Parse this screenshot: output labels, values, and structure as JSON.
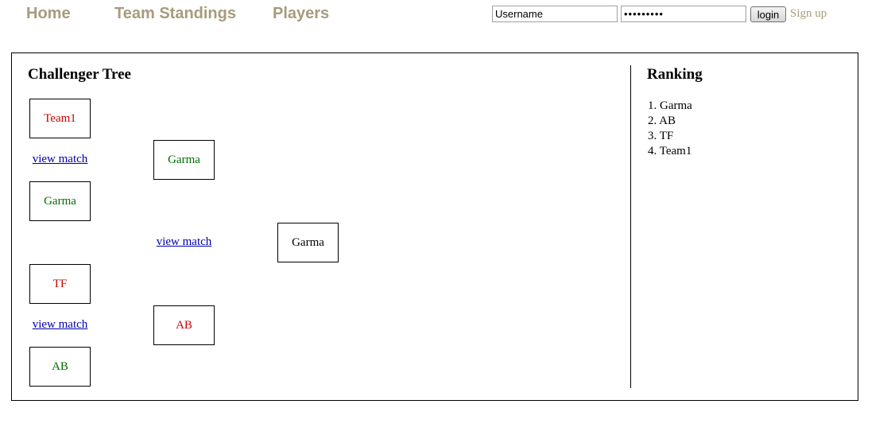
{
  "nav": {
    "home": "Home",
    "team_standings": "Team Standings",
    "players": "Players"
  },
  "login": {
    "username_value": "Username",
    "password_value": "•••••••••",
    "login_label": "login",
    "signup_label": "Sign up"
  },
  "tree": {
    "title": "Challenger Tree",
    "round1": [
      "Team1",
      "Garma",
      "TF",
      "AB"
    ],
    "round2": [
      "Garma",
      "AB"
    ],
    "final": "Garma",
    "view_match_label": "view match"
  },
  "ranking": {
    "title": "Ranking",
    "items": [
      "1. Garma",
      "2. AB",
      "3. TF",
      "4. Team1"
    ]
  },
  "colors": {
    "nav": "#a89b7c",
    "winner": "#006e00",
    "loser": "#cc0000",
    "link": "#0000aa"
  }
}
